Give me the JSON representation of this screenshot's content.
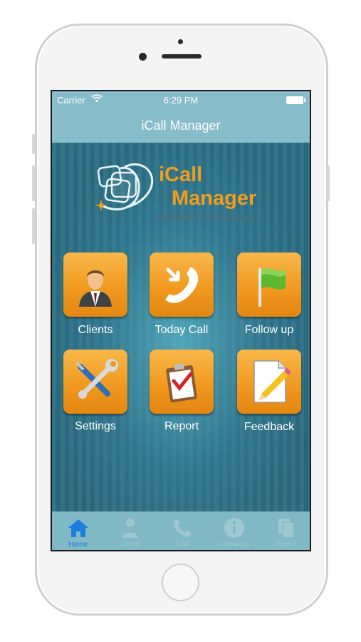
{
  "status_bar": {
    "carrier": "Carrier",
    "time": "6:29 PM"
  },
  "nav": {
    "title": "iCall Manager"
  },
  "logo": {
    "line1": "iCall",
    "line2": "Manager",
    "company": "Redspark Technologies"
  },
  "tiles": [
    {
      "label": "Clients",
      "icon": "businessman-icon"
    },
    {
      "label": "Today Call",
      "icon": "phone-call-icon"
    },
    {
      "label": "Follow up",
      "icon": "green-flag-icon"
    },
    {
      "label": "Settings",
      "icon": "wrench-screwdriver-icon"
    },
    {
      "label": "Report",
      "icon": "clipboard-check-icon"
    },
    {
      "label": "Feedback",
      "icon": "paper-pencil-icon"
    }
  ],
  "tabbar": {
    "active": "Home",
    "items": [
      {
        "label": "Home",
        "icon": "home-icon"
      },
      {
        "label": "Client",
        "icon": "person-icon"
      },
      {
        "label": "Call",
        "icon": "phone-icon"
      },
      {
        "label": "Follow-Up",
        "icon": "info-icon"
      },
      {
        "label": "Report",
        "icon": "documents-icon"
      }
    ]
  },
  "colors": {
    "accent": "#f29c1b",
    "tab_active": "#1c7fde",
    "bar": "#87bccb",
    "background": "#2b6f85"
  }
}
